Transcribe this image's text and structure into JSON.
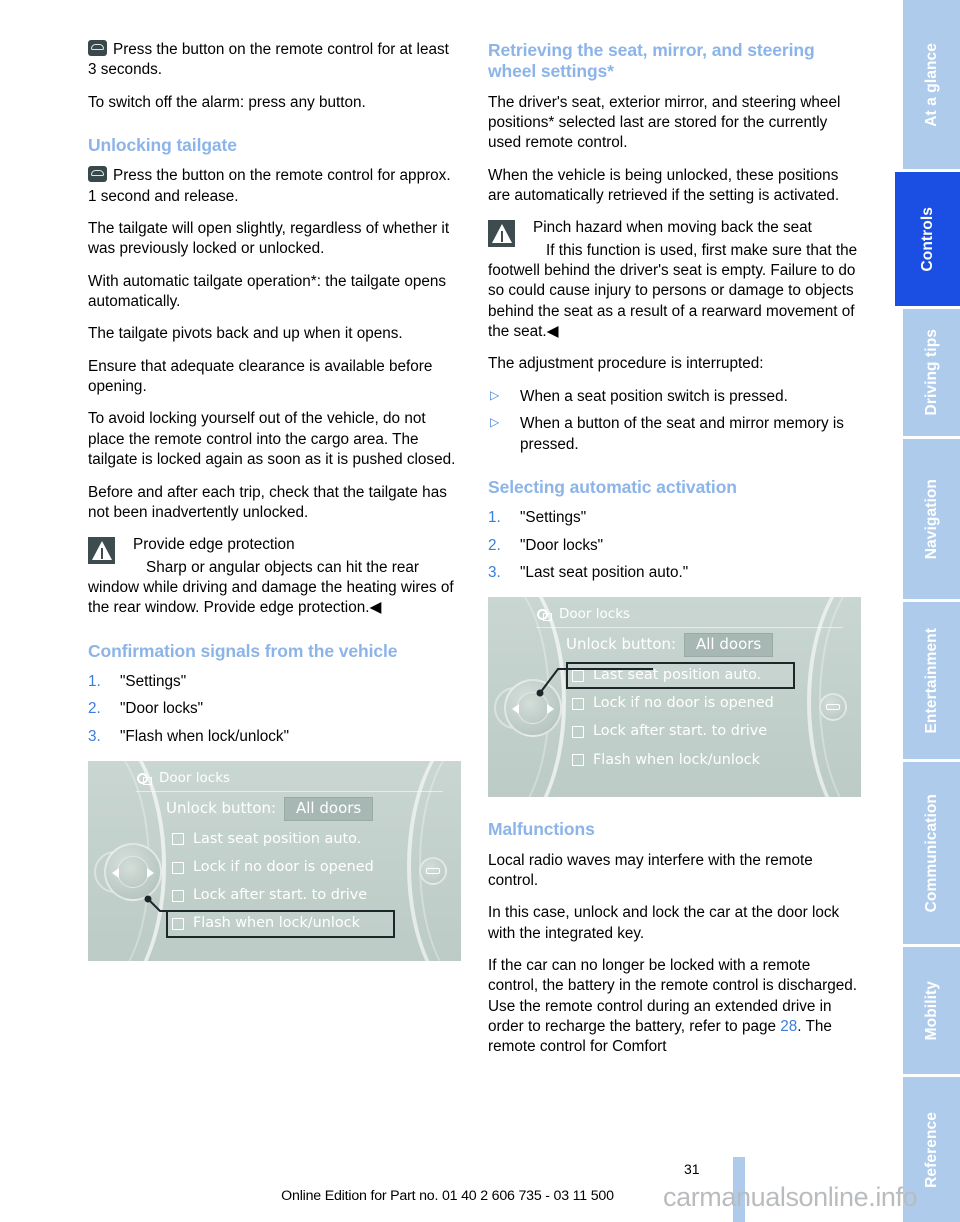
{
  "sidebar": {
    "tabs": [
      {
        "label": "At a glance",
        "active": false
      },
      {
        "label": "Controls",
        "active": true
      },
      {
        "label": "Driving tips",
        "active": false
      },
      {
        "label": "Navigation",
        "active": false
      },
      {
        "label": "Entertainment",
        "active": false
      },
      {
        "label": "Communication",
        "active": false
      },
      {
        "label": "Mobility",
        "active": false
      },
      {
        "label": "Reference",
        "active": false
      }
    ],
    "active_color": "#1b4fe3",
    "inactive_color": "#aecbeb"
  },
  "left_column": {
    "para_remote_3s": "Press the button on the remote control for at least 3 seconds.",
    "para_switch_off_alarm": "To switch off the alarm: press any button.",
    "heading_unlocking_tailgate": "Unlocking tailgate",
    "para_remote_1s": "Press the button on the remote control for approx. 1 second and release.",
    "para_open_slightly": "The tailgate will open slightly, regardless of whether it was previously locked or unlocked.",
    "para_automatic_operation": "With automatic tailgate operation*: the tailgate opens automatically.",
    "para_pivots": "The tailgate pivots back and up when it opens.",
    "para_clearance": "Ensure that adequate clearance is available before opening.",
    "para_avoid_locking_out": "To avoid locking yourself out of the vehicle, do not place the remote control into the cargo area. The tailgate is locked again as soon as it is pushed closed.",
    "para_before_after_trip": "Before and after each trip, check that the tailgate has not been inadvertently unlocked.",
    "warning_edge": {
      "title": "Provide edge protection",
      "text": "Sharp or angular objects can hit the rear window while driving and damage the heating wires of the rear window. Provide edge protection.◀"
    },
    "heading_confirmation": "Confirmation signals from the vehicle",
    "steps_confirmation": [
      {
        "num": "1.",
        "label": "\"Settings\""
      },
      {
        "num": "2.",
        "label": "\"Door locks\""
      },
      {
        "num": "3.",
        "label": "\"Flash when lock/unlock\""
      }
    ]
  },
  "right_column": {
    "heading_retrieving": "Retrieving the seat, mirror, and steering wheel settings*",
    "para_positions_stored": "The driver's seat, exterior mirror, and steering wheel positions* selected last are stored for the currently used remote control.",
    "para_unlocked_retrieved": "When the vehicle is being unlocked, these positions are automatically retrieved if the setting is activated.",
    "warning_pinch": {
      "title": "Pinch hazard when moving back the seat",
      "text": "If this function is used, first make sure that the footwell behind the driver's seat is empty. Failure to do so could cause injury to persons or damage to objects behind the seat as a result of a rearward movement of the seat.◀"
    },
    "para_interrupted": "The adjustment procedure is interrupted:",
    "bullets_interrupted": [
      "When a seat position switch is pressed.",
      "When a button of the seat and mirror memory is pressed."
    ],
    "heading_selecting_auto": "Selecting automatic activation",
    "steps_selecting": [
      {
        "num": "1.",
        "label": "\"Settings\""
      },
      {
        "num": "2.",
        "label": "\"Door locks\""
      },
      {
        "num": "3.",
        "label": "\"Last seat position auto.\""
      }
    ],
    "heading_malfunctions": "Malfunctions",
    "para_radio_waves": "Local radio waves may interfere with the remote control.",
    "para_integrated_key": "In this case, unlock and lock the car at the door lock with the integrated key.",
    "para_battery_pre": "If the car can no longer be locked with a remote control, the battery in the remote control is discharged. Use the remote control during an extended drive in order to recharge the battery, refer to page ",
    "para_battery_pagelink": "28",
    "para_battery_post": ". The remote control for Comfort"
  },
  "mmi_flash": {
    "title": "Door locks",
    "unlock_label": "Unlock button:",
    "unlock_value": "All doors",
    "options": [
      {
        "label": "Last seat position auto.",
        "selected": false
      },
      {
        "label": "Lock if no door is opened",
        "selected": false
      },
      {
        "label": "Lock after start. to drive",
        "selected": false
      },
      {
        "label": "Flash when lock/unlock",
        "selected": true
      }
    ]
  },
  "mmi_lastseat": {
    "title": "Door locks",
    "unlock_label": "Unlock button:",
    "unlock_value": "All doors",
    "options": [
      {
        "label": "Last seat position auto.",
        "selected": true
      },
      {
        "label": "Lock if no door is opened",
        "selected": false
      },
      {
        "label": "Lock after start. to drive",
        "selected": false
      },
      {
        "label": "Flash when lock/unlock",
        "selected": false
      }
    ]
  },
  "footer": {
    "page_number": "31",
    "edition_line": "Online Edition for Part no. 01 40 2 606 735 - 03 11 500",
    "watermark": "carmanualsonline.info"
  }
}
